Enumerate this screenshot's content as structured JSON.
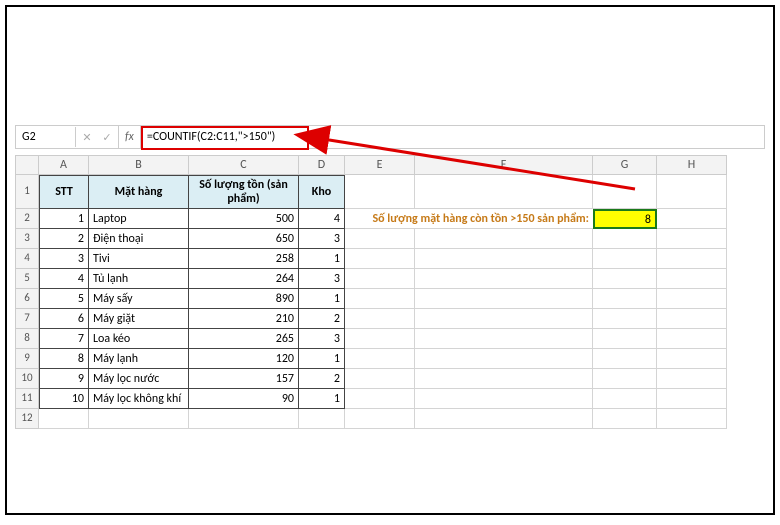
{
  "nameBox": "G2",
  "formula": "=COUNTIF(C2:C11,\">150\")",
  "fxLabel": "fx",
  "columns": [
    "A",
    "B",
    "C",
    "D",
    "E",
    "F",
    "G",
    "H"
  ],
  "rowNums": [
    "1",
    "2",
    "3",
    "4",
    "5",
    "6",
    "7",
    "8",
    "9",
    "10",
    "11",
    "12"
  ],
  "headers": {
    "stt": "STT",
    "mathang": "Mặt hàng",
    "soluong": "Số lượng tồn (sản phẩm)",
    "kho": "Kho"
  },
  "rows": [
    {
      "stt": "1",
      "mh": "Laptop",
      "sl": "500",
      "kho": "4"
    },
    {
      "stt": "2",
      "mh": "Điện thoại",
      "sl": "650",
      "kho": "3"
    },
    {
      "stt": "3",
      "mh": "Tivi",
      "sl": "258",
      "kho": "1"
    },
    {
      "stt": "4",
      "mh": "Tủ lạnh",
      "sl": "264",
      "kho": "3"
    },
    {
      "stt": "5",
      "mh": "Máy sấy",
      "sl": "890",
      "kho": "1"
    },
    {
      "stt": "6",
      "mh": "Máy giặt",
      "sl": "210",
      "kho": "2"
    },
    {
      "stt": "7",
      "mh": "Loa kéo",
      "sl": "265",
      "kho": "3"
    },
    {
      "stt": "8",
      "mh": "Máy lạnh",
      "sl": "120",
      "kho": "1"
    },
    {
      "stt": "9",
      "mh": "Máy lọc nước",
      "sl": "157",
      "kho": "2"
    },
    {
      "stt": "10",
      "mh": "Máy lọc không khí",
      "sl": "90",
      "kho": "1"
    }
  ],
  "note": "Số lượng mặt hàng còn tồn >150 sản phẩm:",
  "result": "8"
}
